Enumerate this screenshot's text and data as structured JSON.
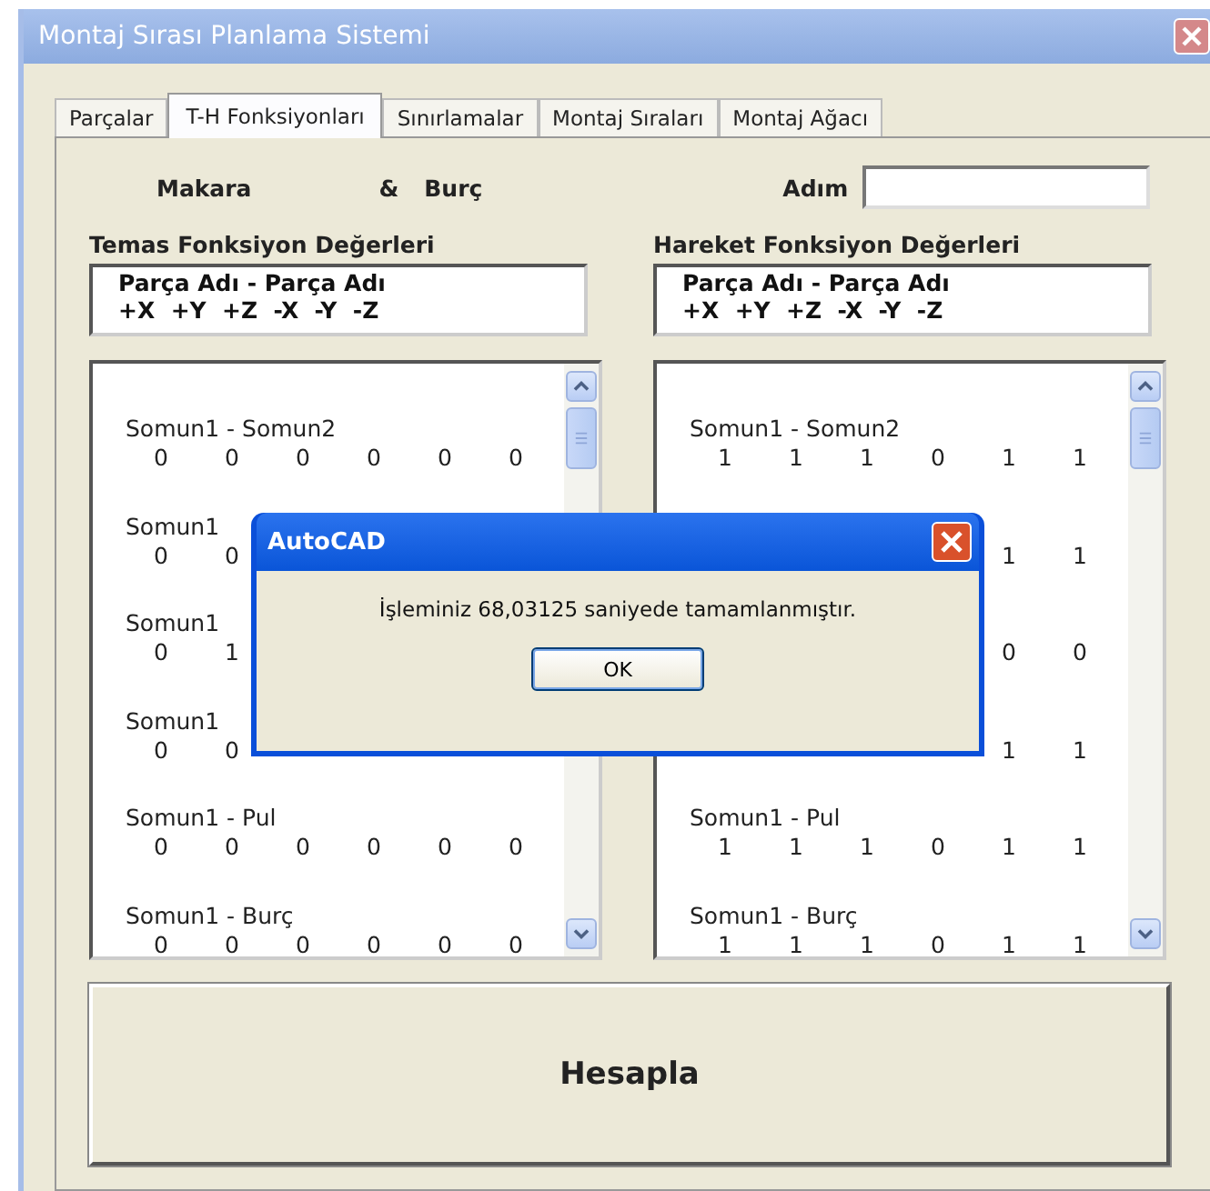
{
  "window": {
    "title": "Montaj Sırası Planlama Sistemi"
  },
  "tabs": [
    {
      "label": "Parçalar",
      "selected": false
    },
    {
      "label": "T-H Fonksiyonları",
      "selected": true
    },
    {
      "label": "Sınırlamalar",
      "selected": false
    },
    {
      "label": "Montaj Sıraları",
      "selected": false
    },
    {
      "label": "Montaj Ağacı",
      "selected": false
    }
  ],
  "parts": {
    "first": "Makara",
    "joiner": "&",
    "second": "Burç"
  },
  "step": {
    "label": "Adım"
  },
  "panels": [
    {
      "title": "Temas Fonksiyon Değerleri",
      "header": [
        "Parça Adı - Parça Adı",
        "+X  +Y  +Z  -X  -Y  -Z"
      ],
      "items": [
        {
          "name": "Somun1 - Somun2",
          "values": [
            "0",
            "0",
            "0",
            "0",
            "0",
            "0"
          ]
        },
        {
          "name": "Somun1",
          "values": [
            "0",
            "0"
          ]
        },
        {
          "name": "Somun1",
          "values": [
            "0",
            "1"
          ]
        },
        {
          "name": "Somun1",
          "values": [
            "0",
            "0"
          ]
        },
        {
          "name": "Somun1 - Pul",
          "values": [
            "0",
            "0",
            "0",
            "0",
            "0",
            "0"
          ]
        },
        {
          "name": "Somun1 - Burç",
          "values": [
            "0",
            "0",
            "0",
            "0",
            "0",
            "0"
          ]
        }
      ]
    },
    {
      "title": "Hareket Fonksiyon Değerleri",
      "header": [
        "Parça Adı - Parça Adı",
        "+X  +Y  +Z  -X  -Y  -Z"
      ],
      "items": [
        {
          "name": "Somun1 - Somun2",
          "values": [
            "1",
            "1",
            "1",
            "0",
            "1",
            "1"
          ]
        },
        {
          "values": [
            "1",
            "1"
          ],
          "leading_hidden": true
        },
        {
          "values": [
            "0",
            "0"
          ],
          "leading_hidden": true
        },
        {
          "values": [
            "1",
            "1"
          ],
          "leading_hidden": true
        },
        {
          "name": "Somun1 - Pul",
          "values": [
            "1",
            "1",
            "1",
            "0",
            "1",
            "1"
          ]
        },
        {
          "name": "Somun1 - Burç",
          "values": [
            "1",
            "1",
            "1",
            "0",
            "1",
            "1"
          ]
        }
      ]
    }
  ],
  "compute_button": "Hesapla",
  "dialog": {
    "title": "AutoCAD",
    "message": "İşleminiz 68,03125 saniyede tamamlanmıştır.",
    "button": "OK"
  }
}
